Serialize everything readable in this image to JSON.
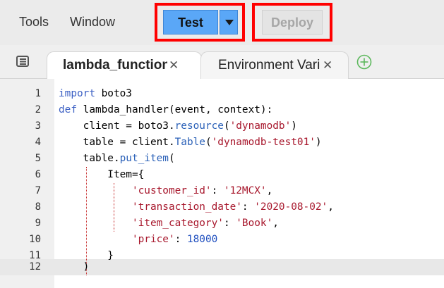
{
  "toolbar": {
    "menu_tools": "Tools",
    "menu_window": "Window",
    "test_label": "Test",
    "deploy_label": "Deploy"
  },
  "tabs": [
    {
      "label": "lambda_function",
      "active": true
    },
    {
      "label": "Environment Vari",
      "active": false
    }
  ],
  "editor": {
    "line_numbers": [
      "1",
      "2",
      "3",
      "4",
      "5",
      "6",
      "7",
      "8",
      "9",
      "10",
      "11",
      "12"
    ],
    "lines": [
      "import boto3",
      "def lambda_handler(event, context):",
      "    client = boto3.resource('dynamodb')",
      "    table = client.Table('dynamodb-test01')",
      "    table.put_item(",
      "        Item={",
      "            'customer_id': '12MCX',",
      "            'transaction_date': '2020-08-02',",
      "            'item_category': 'Book',",
      "            'price': 18000",
      "        }",
      "    )"
    ]
  },
  "colors": {
    "test_button": "#5aa7f7",
    "highlight_box": "#ff0000",
    "keyword": "#3d61c4",
    "string": "#a8182d",
    "add_tab_icon": "#5cb85c"
  }
}
